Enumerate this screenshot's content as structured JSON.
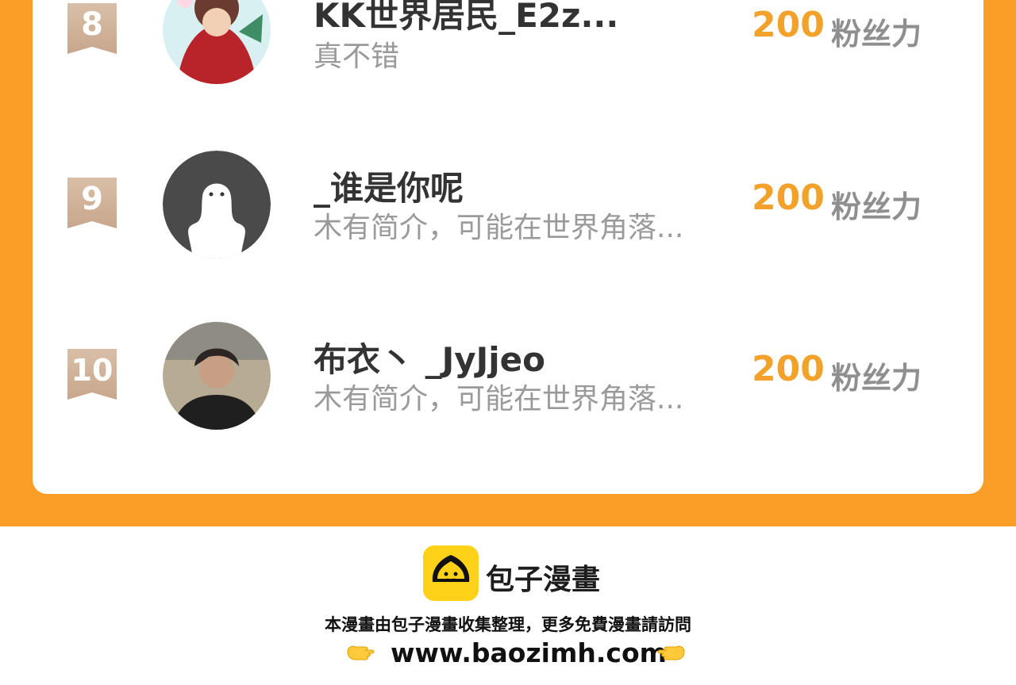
{
  "ranking": {
    "entries": [
      {
        "rank": "8",
        "name": "KK世界居民_E2z...",
        "bio": "真不错",
        "score": "200",
        "unit": "粉丝力"
      },
      {
        "rank": "9",
        "name": "_谁是你呢",
        "bio": "木有简介，可能在世界角落...",
        "score": "200",
        "unit": "粉丝力"
      },
      {
        "rank": "10",
        "name": "布衣丶 _JyJjeo",
        "bio": "木有简介，可能在世界角落...",
        "score": "200",
        "unit": "粉丝力"
      }
    ]
  },
  "footer": {
    "brand": "包子漫畫",
    "note": "本漫畫由包子漫畫收集整理，更多免費漫畫請訪問",
    "url": "www.baozimh.com"
  },
  "colors": {
    "panel": "#fb9e28",
    "score": "#f2a22b",
    "rank_badge": "#c8a68c",
    "logo": "#ffd21a"
  },
  "icons": {
    "avatar_8": "anime-character-avatar",
    "avatar_9": "default-ghost-avatar",
    "avatar_10": "photo-avatar",
    "logo": "bun-logo-icon",
    "left_hand": "pointing-right-hand-icon",
    "right_hand": "pointing-left-hand-icon"
  }
}
